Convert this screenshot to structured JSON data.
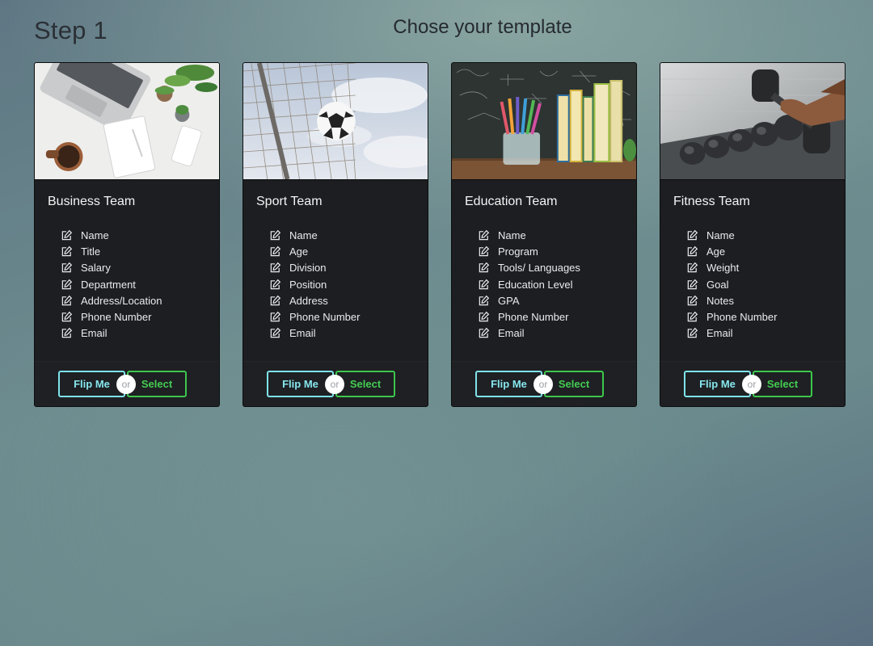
{
  "step_label": "Step 1",
  "heading": "Chose your template",
  "cards": [
    {
      "title": "Business Team",
      "image": "business-desk-photo",
      "fields": [
        "Name",
        "Title",
        "Salary",
        "Department",
        "Address/Location",
        "Phone Number",
        "Email"
      ],
      "flip_label": "Flip Me",
      "or_label": "or",
      "select_label": "Select"
    },
    {
      "title": "Sport Team",
      "image": "soccer-goal-photo",
      "fields": [
        "Name",
        "Age",
        "Division",
        "Position",
        "Address",
        "Phone Number",
        "Email"
      ],
      "flip_label": "Flip Me",
      "or_label": "or",
      "select_label": "Select"
    },
    {
      "title": "Education Team",
      "image": "books-pencils-photo",
      "fields": [
        "Name",
        "Program",
        "Tools/ Languages",
        "Education Level",
        "GPA",
        "Phone Number",
        "Email"
      ],
      "flip_label": "Flip Me",
      "or_label": "or",
      "select_label": "Select"
    },
    {
      "title": "Fitness Team",
      "image": "dumbbell-rack-photo",
      "fields": [
        "Name",
        "Age",
        "Weight",
        "Goal",
        "Notes",
        "Phone Number",
        "Email"
      ],
      "flip_label": "Flip Me",
      "or_label": "or",
      "select_label": "Select"
    }
  ],
  "colors": {
    "flip_accent": "#86e6ee",
    "select_accent": "#44cc52",
    "card_background": "#1c1e21"
  },
  "icons": {
    "field_icon": "edit-icon"
  }
}
